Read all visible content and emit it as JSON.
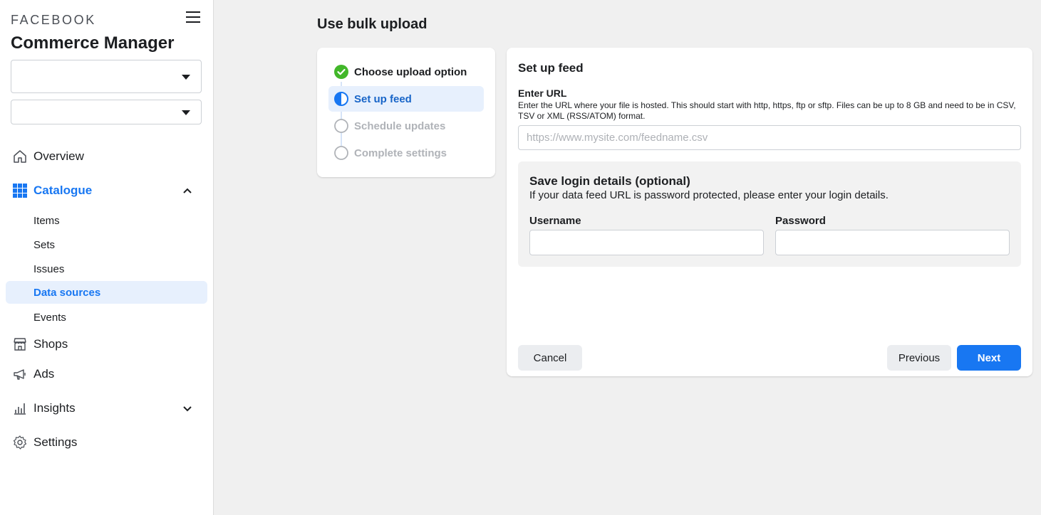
{
  "sidebar": {
    "brand": "FACEBOOK",
    "app_title": "Commerce Manager",
    "nav": {
      "overview": "Overview",
      "catalogue": "Catalogue",
      "shops": "Shops",
      "ads": "Ads",
      "insights": "Insights",
      "settings": "Settings"
    },
    "catalogue_items": [
      "Items",
      "Sets",
      "Issues",
      "Data sources",
      "Events"
    ],
    "active_sub_item": "Data sources"
  },
  "main": {
    "page_title": "Use bulk upload",
    "steps": [
      {
        "label": "Choose upload option",
        "status": "done"
      },
      {
        "label": "Set up feed",
        "status": "current"
      },
      {
        "label": "Schedule updates",
        "status": "pending"
      },
      {
        "label": "Complete settings",
        "status": "pending"
      }
    ],
    "form": {
      "title": "Set up feed",
      "url_label": "Enter URL",
      "url_help": "Enter the URL where your file is hosted. This should start with http, https, ftp or sftp. Files can be up to 8 GB and need to be in CSV, TSV or XML (RSS/ATOM) format.",
      "url_placeholder": "https://www.mysite.com/feedname.csv",
      "login": {
        "title": "Save login details (optional)",
        "help": "If your data feed URL is password protected, please enter your login details.",
        "username_label": "Username",
        "password_label": "Password"
      },
      "buttons": {
        "cancel": "Cancel",
        "previous": "Previous",
        "next": "Next"
      }
    }
  },
  "colors": {
    "accent": "#1877f2",
    "success": "#42b72a",
    "active_bg": "#e7f0fd"
  }
}
